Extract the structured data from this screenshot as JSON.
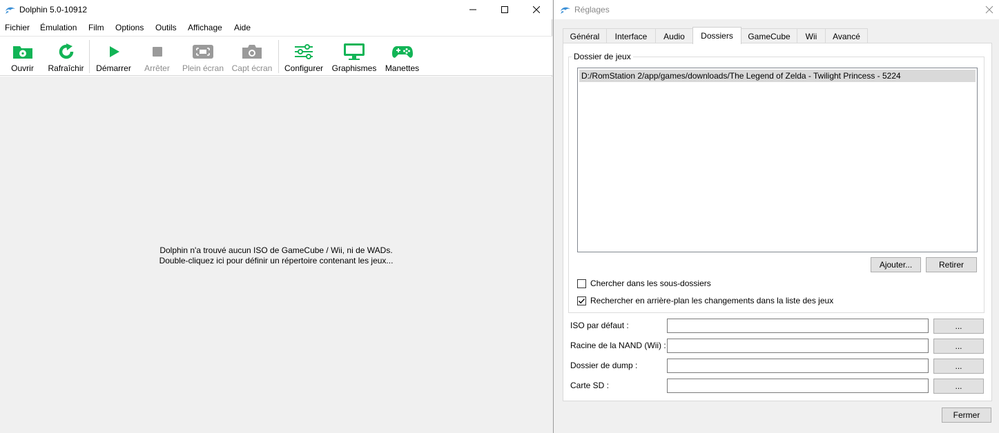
{
  "main_window": {
    "title": "Dolphin 5.0-10912",
    "menu": [
      "Fichier",
      "Émulation",
      "Film",
      "Options",
      "Outils",
      "Affichage",
      "Aide"
    ],
    "toolbar": {
      "open": "Ouvrir",
      "refresh": "Rafraîchir",
      "play": "Démarrer",
      "stop": "Arrêter",
      "fullscreen": "Plein écran",
      "screenshot": "Capt écran",
      "config": "Configurer",
      "graphics": "Graphismes",
      "controllers": "Manettes"
    },
    "empty_line1": "Dolphin n'a trouvé aucun ISO de GameCube / Wii, ni de WADs.",
    "empty_line2": "Double-cliquez ici pour définir un répertoire contenant les jeux..."
  },
  "settings": {
    "title": "Réglages",
    "tabs": [
      "Général",
      "Interface",
      "Audio",
      "Dossiers",
      "GameCube",
      "Wii",
      "Avancé"
    ],
    "active_tab": "Dossiers",
    "group_title": "Dossier de jeux",
    "paths": [
      "D:/RomStation 2/app/games/downloads/The Legend of Zelda - Twilight Princess - 5224"
    ],
    "add_button": "Ajouter...",
    "remove_button": "Retirer",
    "check_subdirs": {
      "label": "Chercher dans les sous-dossiers",
      "checked": false
    },
    "check_watch": {
      "label": "Rechercher en arrière-plan les changements dans la liste des jeux",
      "checked": true
    },
    "fields": {
      "default_iso": {
        "label": "ISO par défaut :",
        "value": "",
        "browse": "..."
      },
      "nand_root": {
        "label": "Racine de la NAND (Wii) :",
        "value": "",
        "browse": "..."
      },
      "dump_dir": {
        "label": "Dossier de dump :",
        "value": "",
        "browse": "..."
      },
      "sd_card": {
        "label": "Carte SD :",
        "value": "",
        "browse": "..."
      }
    },
    "close_button": "Fermer"
  },
  "colors": {
    "accent_green": "#12b456",
    "disabled_gray": "#9a9a9a",
    "dolphin_blue": "#3a8fd6"
  }
}
